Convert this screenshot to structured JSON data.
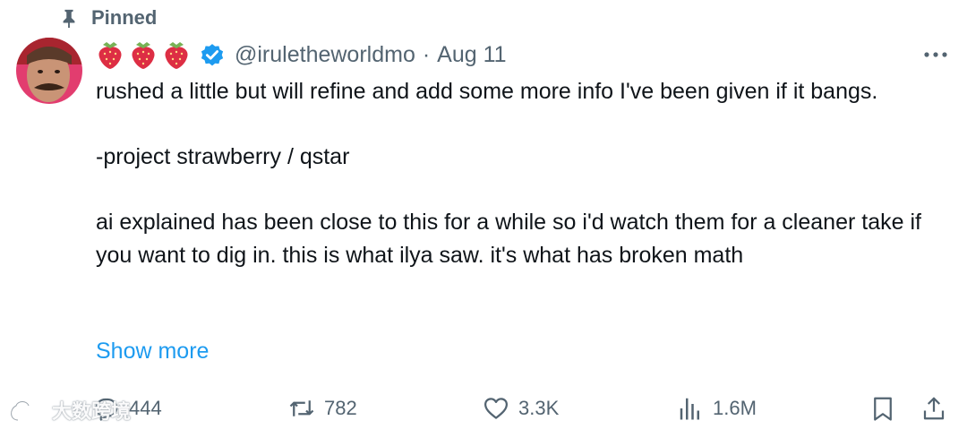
{
  "pinned": {
    "label": "Pinned"
  },
  "author": {
    "emoji": [
      "strawberry",
      "strawberry",
      "strawberry"
    ],
    "handle": "@iruletheworldmo",
    "separator": "·",
    "date": "Aug 11",
    "verified": true
  },
  "tweet": {
    "paragraphs": [
      "rushed a little but will refine and add some more info I've been given if it bangs.",
      "-project strawberry / qstar",
      "ai explained has been close to this for a while so i'd watch them for a cleaner take if you want to dig in. this is what ilya saw. it's what has broken math"
    ],
    "show_more": "Show more"
  },
  "stats": {
    "replies": "444",
    "reposts": "782",
    "likes": "3.3K",
    "views": "1.6M"
  },
  "watermark": {
    "text": "大数跨境"
  },
  "colors": {
    "accent": "#1d9bf0",
    "muted": "#536471",
    "text": "#0f1419"
  },
  "icons": [
    "pin-icon",
    "verified-badge-icon",
    "more-options-icon",
    "reply-icon",
    "repost-icon",
    "like-icon",
    "views-icon",
    "bookmark-icon",
    "share-icon"
  ]
}
